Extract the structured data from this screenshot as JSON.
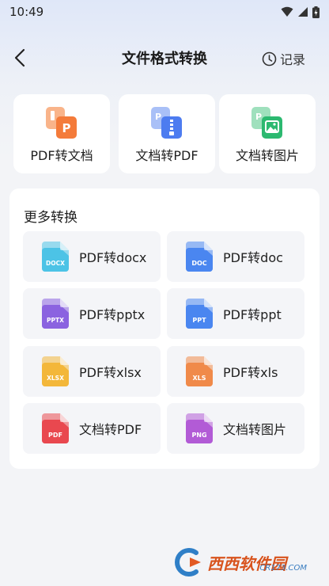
{
  "status": {
    "time": "10:49"
  },
  "header": {
    "title": "文件格式转换",
    "record_label": "记录"
  },
  "top_cards": [
    {
      "label": "PDF转文档",
      "icon": "pdf-to-doc-icon",
      "color": "#f47b3a"
    },
    {
      "label": "文档转PDF",
      "icon": "doc-to-pdf-icon",
      "color": "#4d7cf0"
    },
    {
      "label": "文档转图片",
      "icon": "doc-to-image-icon",
      "color": "#2cb970"
    }
  ],
  "more": {
    "title": "更多转换",
    "items": [
      {
        "label": "PDF转docx",
        "badge": "DOCX",
        "color": "#4cc3e6"
      },
      {
        "label": "PDF转doc",
        "badge": "DOC",
        "color": "#4a86f0"
      },
      {
        "label": "PDF转pptx",
        "badge": "PPTX",
        "color": "#8b63e0"
      },
      {
        "label": "PDF转ppt",
        "badge": "PPT",
        "color": "#4a86f0"
      },
      {
        "label": "PDF转xlsx",
        "badge": "XLSX",
        "color": "#f3b73a"
      },
      {
        "label": "PDF转xls",
        "badge": "XLS",
        "color": "#f08a4a"
      },
      {
        "label": "文档转PDF",
        "badge": "PDF",
        "color": "#e9484f"
      },
      {
        "label": "文档转图片",
        "badge": "PNG",
        "color": "#b25bd6"
      }
    ]
  },
  "watermark": {
    "main": "西西软件园",
    "sub": "CR173.COM"
  }
}
